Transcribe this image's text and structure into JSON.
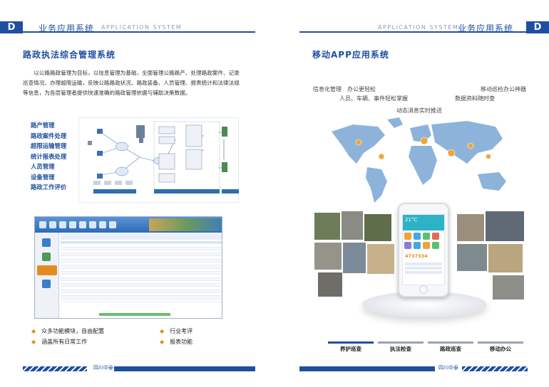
{
  "left_header": {
    "letter": "D",
    "title": "业务应用系统",
    "subtitle": "APPLICATION SYSTEM"
  },
  "right_header": {
    "letter": "D",
    "title": "业务应用系统",
    "subtitle": "APPLICATION SYSTEM"
  },
  "left": {
    "section_title": "路政执法综合管理系统",
    "intro": "以公路路政管理为目标，以信息管理为基础，全面管理公路路产、处理路政案件、记录巡查情况、办理超限运输，反映公路路政状况、路政装备、人员管理、报表统计和法律法规等信息，为各层管理者提供快速准确的路政管理依据与辅助决策数据。",
    "functions": [
      "路产管理",
      "路政案件处理",
      "超限运输管理",
      "统计报表处理",
      "人员管理",
      "设备管理",
      "路政工作评价"
    ],
    "bullets": [
      "众多功能模块，自由配置",
      "行业考评",
      "涵盖所有日常工作",
      "报表功能"
    ],
    "footer_label": "四川中泰"
  },
  "right": {
    "section_title": "移动APP应用系统",
    "features": [
      "信息化管理",
      "办公更轻松",
      "人员、车辆、事件轻松掌握",
      "移动巡检办公神器",
      "数据资料随时查",
      "动态消息实时推送"
    ],
    "phone_temp": "21°C",
    "phone_number": "4737334",
    "tabs": [
      "养护巡查",
      "执法检查",
      "路政巡查",
      "移动办公"
    ],
    "footer_label": "四川中泰"
  },
  "colors": {
    "brand": "#1f4fa0",
    "accent": "#e78a1e"
  }
}
